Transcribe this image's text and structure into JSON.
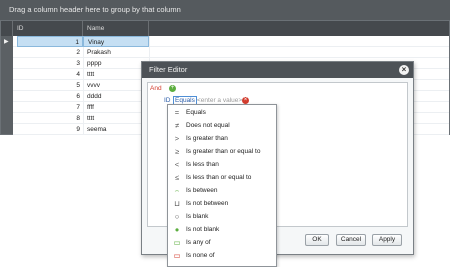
{
  "group_panel": {
    "text": "Drag a column header here to group by that column"
  },
  "grid": {
    "columns": [
      "ID",
      "Name"
    ],
    "rows": [
      {
        "id": "1",
        "name": "Vinay"
      },
      {
        "id": "2",
        "name": "Prakash"
      },
      {
        "id": "3",
        "name": "pppp"
      },
      {
        "id": "4",
        "name": "tttt"
      },
      {
        "id": "5",
        "name": "vvvv"
      },
      {
        "id": "6",
        "name": "dddd"
      },
      {
        "id": "7",
        "name": "ffff"
      },
      {
        "id": "8",
        "name": "tttt"
      },
      {
        "id": "9",
        "name": "seema"
      }
    ]
  },
  "dialog": {
    "title": "Filter Editor",
    "logic": "And",
    "condition": {
      "field": "ID",
      "operator": "Equals",
      "value_placeholder": "<enter a value>"
    },
    "buttons": {
      "ok": "OK",
      "cancel": "Cancel",
      "apply": "Apply"
    }
  },
  "operators": [
    {
      "icon": "equals-icon",
      "glyph": "=",
      "label": "Equals"
    },
    {
      "icon": "not-equal-icon",
      "glyph": "≠",
      "label": "Does not equal"
    },
    {
      "icon": "greater-than-icon",
      "glyph": ">",
      "label": "Is greater than"
    },
    {
      "icon": "greater-equal-icon",
      "glyph": "≥",
      "label": "Is greater than or equal to"
    },
    {
      "icon": "less-than-icon",
      "glyph": "<",
      "label": "Is less than"
    },
    {
      "icon": "less-equal-icon",
      "glyph": "≤",
      "label": "Is less than or equal to"
    },
    {
      "icon": "between-icon",
      "glyph": "⌢",
      "label": "Is between"
    },
    {
      "icon": "not-between-icon",
      "glyph": "⊔",
      "label": "Is not between"
    },
    {
      "icon": "blank-icon",
      "glyph": "○",
      "label": "Is blank"
    },
    {
      "icon": "not-blank-icon",
      "glyph": "●",
      "label": "Is not blank"
    },
    {
      "icon": "any-of-icon",
      "glyph": "▭",
      "label": "Is any of"
    },
    {
      "icon": "none-of-icon",
      "glyph": "▭",
      "label": "Is none of"
    }
  ],
  "colors": {
    "accent": "#4f8fd6",
    "header": "#45494d",
    "selection": "#c5dff3",
    "logic": "#d23b2d",
    "add": "#5cae3f"
  }
}
